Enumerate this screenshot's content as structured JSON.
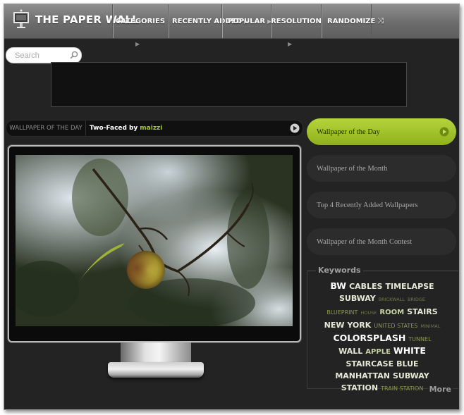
{
  "header": {
    "logo_text": "THE PAPER WALL",
    "logo_icon": "monitor-icon",
    "nav": [
      {
        "label": "CATEGORIES",
        "has_arrow": false,
        "has_sub": true
      },
      {
        "label": "RECENTLY ADDED",
        "has_arrow": true,
        "has_sub": false
      },
      {
        "label": "POPULAR",
        "has_arrow": true,
        "has_sub": false
      },
      {
        "label": "RESOLUTION",
        "has_arrow": false,
        "has_sub": true
      },
      {
        "label": "RANDOMIZE",
        "has_arrow": false,
        "has_sub": false
      }
    ],
    "sub_arrow_glyph": "▶",
    "nav_arrow_glyph": "▶",
    "shuffle_glyph": "⤨"
  },
  "search": {
    "placeholder": "Search",
    "icon": "search-icon"
  },
  "featured": {
    "label": "WALLPAPER OF THE DAY",
    "title": "Two-Faced",
    "by": "by",
    "author": "maizzi",
    "author_color": "#a6c52b"
  },
  "tabs": [
    {
      "label": "Wallpaper of the Day",
      "active": true
    },
    {
      "label": "Wallpaper of the Month",
      "active": false
    },
    {
      "label": "Top 4 Recently Added Wallpapers",
      "active": false
    },
    {
      "label": "Wallpaper of the Month Contest",
      "active": false
    }
  ],
  "keywords": {
    "title": "Keywords",
    "more": "More",
    "lines": [
      [
        {
          "t": "BW",
          "s": 5
        },
        {
          "t": "CABLES",
          "s": 4
        },
        {
          "t": "TIMELAPSE",
          "s": 4
        }
      ],
      [
        {
          "t": "SUBWAY",
          "s": 4
        },
        {
          "t": "BRICKWALL",
          "s": 1
        },
        {
          "t": "BRIDGE",
          "s": 1
        }
      ],
      [
        {
          "t": "BLUEPRINT",
          "s": 2
        },
        {
          "t": "HOUSE",
          "s": 1
        },
        {
          "t": "ROOM",
          "s": 3
        },
        {
          "t": "STAIRS",
          "s": 4
        }
      ],
      [
        {
          "t": "NEW YORK",
          "s": 4
        },
        {
          "t": "UNITED STATES",
          "s": 2
        },
        {
          "t": "MINIMAL",
          "s": 1
        }
      ],
      [
        {
          "t": "COLORSPLASH",
          "s": 5
        },
        {
          "t": "TUNNEL",
          "s": 2
        }
      ],
      [
        {
          "t": "WALL",
          "s": 4
        },
        {
          "t": "APPLE",
          "s": 3
        },
        {
          "t": "WHITE",
          "s": 5
        }
      ],
      [
        {
          "t": "STAIRCASE",
          "s": 4
        },
        {
          "t": "BLUE",
          "s": 4
        }
      ],
      [
        {
          "t": "MANHATTAN",
          "s": 4
        },
        {
          "t": "SUBWAY",
          "s": 4
        }
      ],
      [
        {
          "t": "STATION",
          "s": 4
        },
        {
          "t": "TRAIN STATION",
          "s": 2
        }
      ]
    ]
  },
  "colors": {
    "accent": "#a6c52b",
    "background": "#232323",
    "header": "#7a7a7a"
  }
}
